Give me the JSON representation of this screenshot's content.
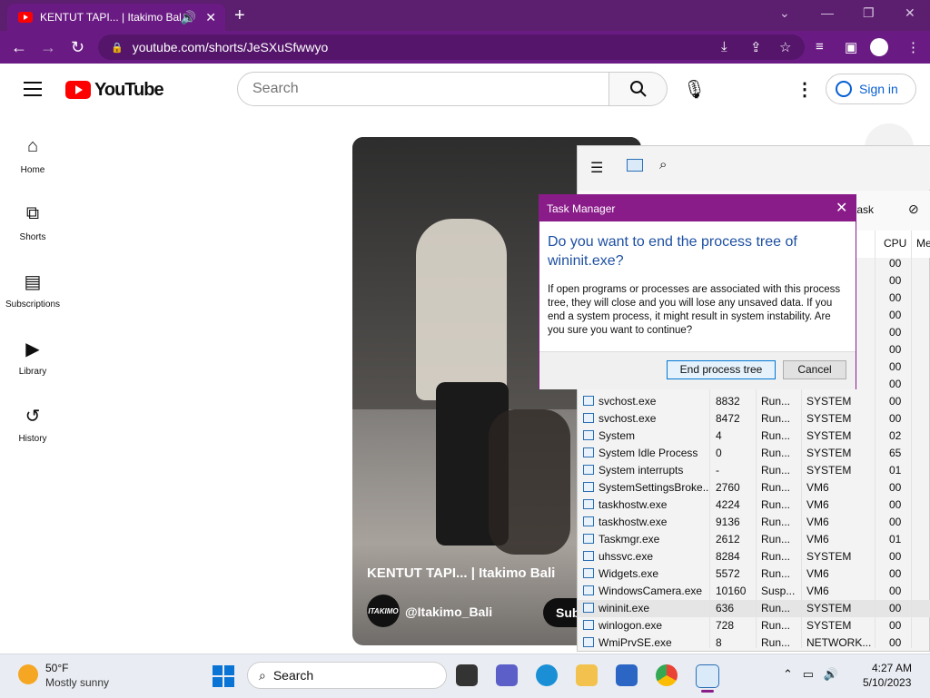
{
  "browser": {
    "tab_title": "KENTUT TAPI... | Itakimo Bali",
    "url": "youtube.com/shorts/JeSXuSfwwyo"
  },
  "youtube": {
    "logo_text": "YouTube",
    "search_placeholder": "Search",
    "sign_in": "Sign in",
    "sidebar": [
      {
        "label": "Home",
        "icon": "home-icon"
      },
      {
        "label": "Shorts",
        "icon": "shorts-icon"
      },
      {
        "label": "Subscriptions",
        "icon": "subscriptions-icon"
      },
      {
        "label": "Library",
        "icon": "library-icon"
      },
      {
        "label": "History",
        "icon": "history-icon"
      }
    ],
    "video": {
      "title": "KENTUT TAPI... | Itakimo Bali",
      "channel": "@Itakimo_Bali",
      "avatar_text": "ITAKIMO",
      "subscribe": "Sub"
    }
  },
  "task_manager": {
    "new_task": "w task",
    "columns": {
      "cpu": "CPU",
      "memory": "Me"
    },
    "cpu_top_rows": [
      "00",
      "00",
      "00",
      "00",
      "00",
      "00",
      "00",
      "00"
    ],
    "processes": [
      {
        "name": "svchost.exe",
        "pid": "8832",
        "status": "Run...",
        "user": "SYSTEM",
        "cpu": "00"
      },
      {
        "name": "svchost.exe",
        "pid": "8472",
        "status": "Run...",
        "user": "SYSTEM",
        "cpu": "00"
      },
      {
        "name": "System",
        "pid": "4",
        "status": "Run...",
        "user": "SYSTEM",
        "cpu": "02"
      },
      {
        "name": "System Idle Process",
        "pid": "0",
        "status": "Run...",
        "user": "SYSTEM",
        "cpu": "65"
      },
      {
        "name": "System interrupts",
        "pid": "-",
        "status": "Run...",
        "user": "SYSTEM",
        "cpu": "01"
      },
      {
        "name": "SystemSettingsBroke...",
        "pid": "2760",
        "status": "Run...",
        "user": "VM6",
        "cpu": "00"
      },
      {
        "name": "taskhostw.exe",
        "pid": "4224",
        "status": "Run...",
        "user": "VM6",
        "cpu": "00"
      },
      {
        "name": "taskhostw.exe",
        "pid": "9136",
        "status": "Run...",
        "user": "VM6",
        "cpu": "00"
      },
      {
        "name": "Taskmgr.exe",
        "pid": "2612",
        "status": "Run...",
        "user": "VM6",
        "cpu": "01"
      },
      {
        "name": "uhssvc.exe",
        "pid": "8284",
        "status": "Run...",
        "user": "SYSTEM",
        "cpu": "00"
      },
      {
        "name": "Widgets.exe",
        "pid": "5572",
        "status": "Run...",
        "user": "VM6",
        "cpu": "00"
      },
      {
        "name": "WindowsCamera.exe",
        "pid": "10160",
        "status": "Susp...",
        "user": "VM6",
        "cpu": "00"
      },
      {
        "name": "wininit.exe",
        "pid": "636",
        "status": "Run...",
        "user": "SYSTEM",
        "cpu": "00",
        "selected": true
      },
      {
        "name": "winlogon.exe",
        "pid": "728",
        "status": "Run...",
        "user": "SYSTEM",
        "cpu": "00"
      },
      {
        "name": "WmiPrvSE.exe",
        "pid": "8",
        "status": "Run...",
        "user": "NETWORK...",
        "cpu": "00"
      }
    ]
  },
  "dialog": {
    "title": "Task Manager",
    "question": "Do you want to end the process tree of wininit.exe?",
    "message": "If open programs or processes are associated with this process tree, they will close and you will lose any unsaved data. If you end a system process, it might result in system instability. Are you sure you want to continue?",
    "confirm": "End process tree",
    "cancel": "Cancel"
  },
  "taskbar": {
    "temperature": "50°F",
    "weather": "Mostly sunny",
    "search": "Search",
    "time": "4:27 AM",
    "date": "5/10/2023"
  }
}
